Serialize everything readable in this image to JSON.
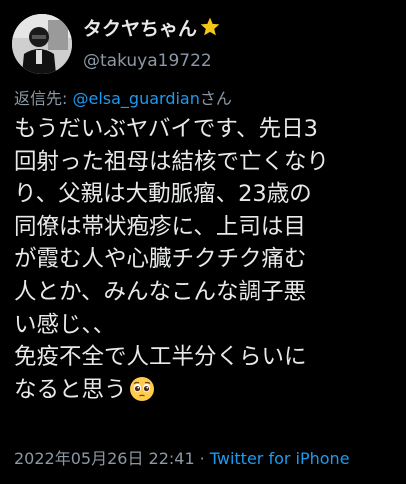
{
  "author": {
    "display_name": "タクヤちゃん",
    "badge_icon": "star-icon",
    "badge_color": "#f5c518",
    "handle": "@takuya19722"
  },
  "reply": {
    "prefix": "返信先:",
    "target": "@elsa_guardian",
    "suffix": "さん"
  },
  "body": {
    "lines": [
      "もうだいぶヤバイです、先日3",
      "回射った祖母は結核で亡くなり",
      "り、父親は大動脈瘤、23歳の",
      "同僚は帯状疱疹に、上司は目",
      "が霞む人や心臓チクチク痛む",
      "人とか、みんなこんな調子悪",
      "い感じ、、",
      "免疫不全で人工半分くらいに",
      "なると思う"
    ],
    "trailing_emoji": "pleading-face-icon"
  },
  "meta": {
    "timestamp": "2022年05月26日 22:41",
    "separator": "·",
    "source": "Twitter for iPhone"
  },
  "colors": {
    "background": "#000000",
    "text": "#e7e9ea",
    "secondary": "#8b98a5",
    "link": "#1d9bf0"
  }
}
